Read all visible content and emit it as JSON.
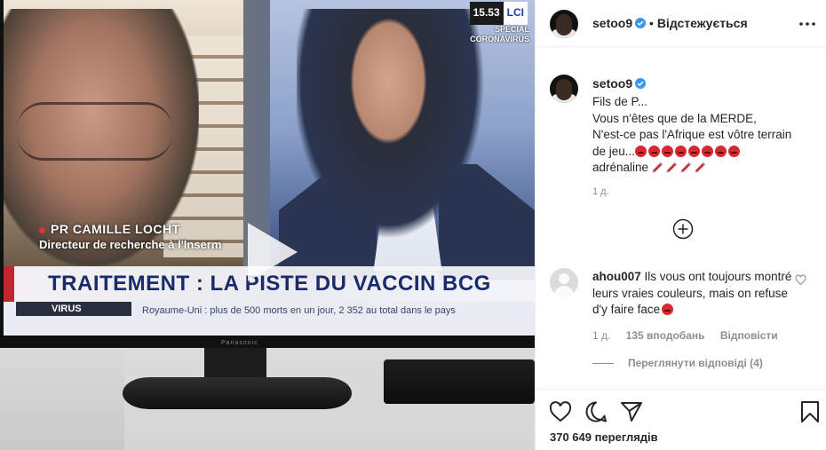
{
  "video": {
    "clock_time": "15.53",
    "channel": "LCI",
    "special_line1": "SPÉCIAL",
    "special_line2": "CORONAVIRUS",
    "guest_name": "PR CAMILLE LOCHT",
    "guest_role": "Directeur de recherche à l'Inserm",
    "headline": "TRAITEMENT : LA PISTE DU VACCIN BCG",
    "ticker_tag": "VIRUS",
    "ticker_text": "Royaume-Uni : plus de 500 morts en un jour, 2 352 au total dans le pays",
    "tv_brand": "Panasonic"
  },
  "header": {
    "username": "setoo9",
    "separator": "•",
    "follow_label": "Відстежується",
    "more_icon": "more-horizontal-icon"
  },
  "caption": {
    "username": "setoo9",
    "line1": "Fils de P...",
    "line2": "Vous n'êtes que de la MERDE,",
    "line3": "N'est-ce pas l'Afrique est vôtre terrain",
    "line4_text": "de jeu...",
    "line5_text": "adrénaline",
    "time": "1 д."
  },
  "comment": {
    "username": "ahou007",
    "text": "Ils vous ont toujours montré leurs vraies couleurs, mais on refuse d'y faire face",
    "time": "1 д.",
    "likes": "135 вподобань",
    "reply_label": "Відповісти",
    "view_replies": "Переглянути відповіді (4)"
  },
  "footer": {
    "views": "370 649 переглядів"
  },
  "colors": {
    "verified": "#3897f0",
    "text": "#262626",
    "muted": "#8e8e8e",
    "border": "#efefef"
  }
}
